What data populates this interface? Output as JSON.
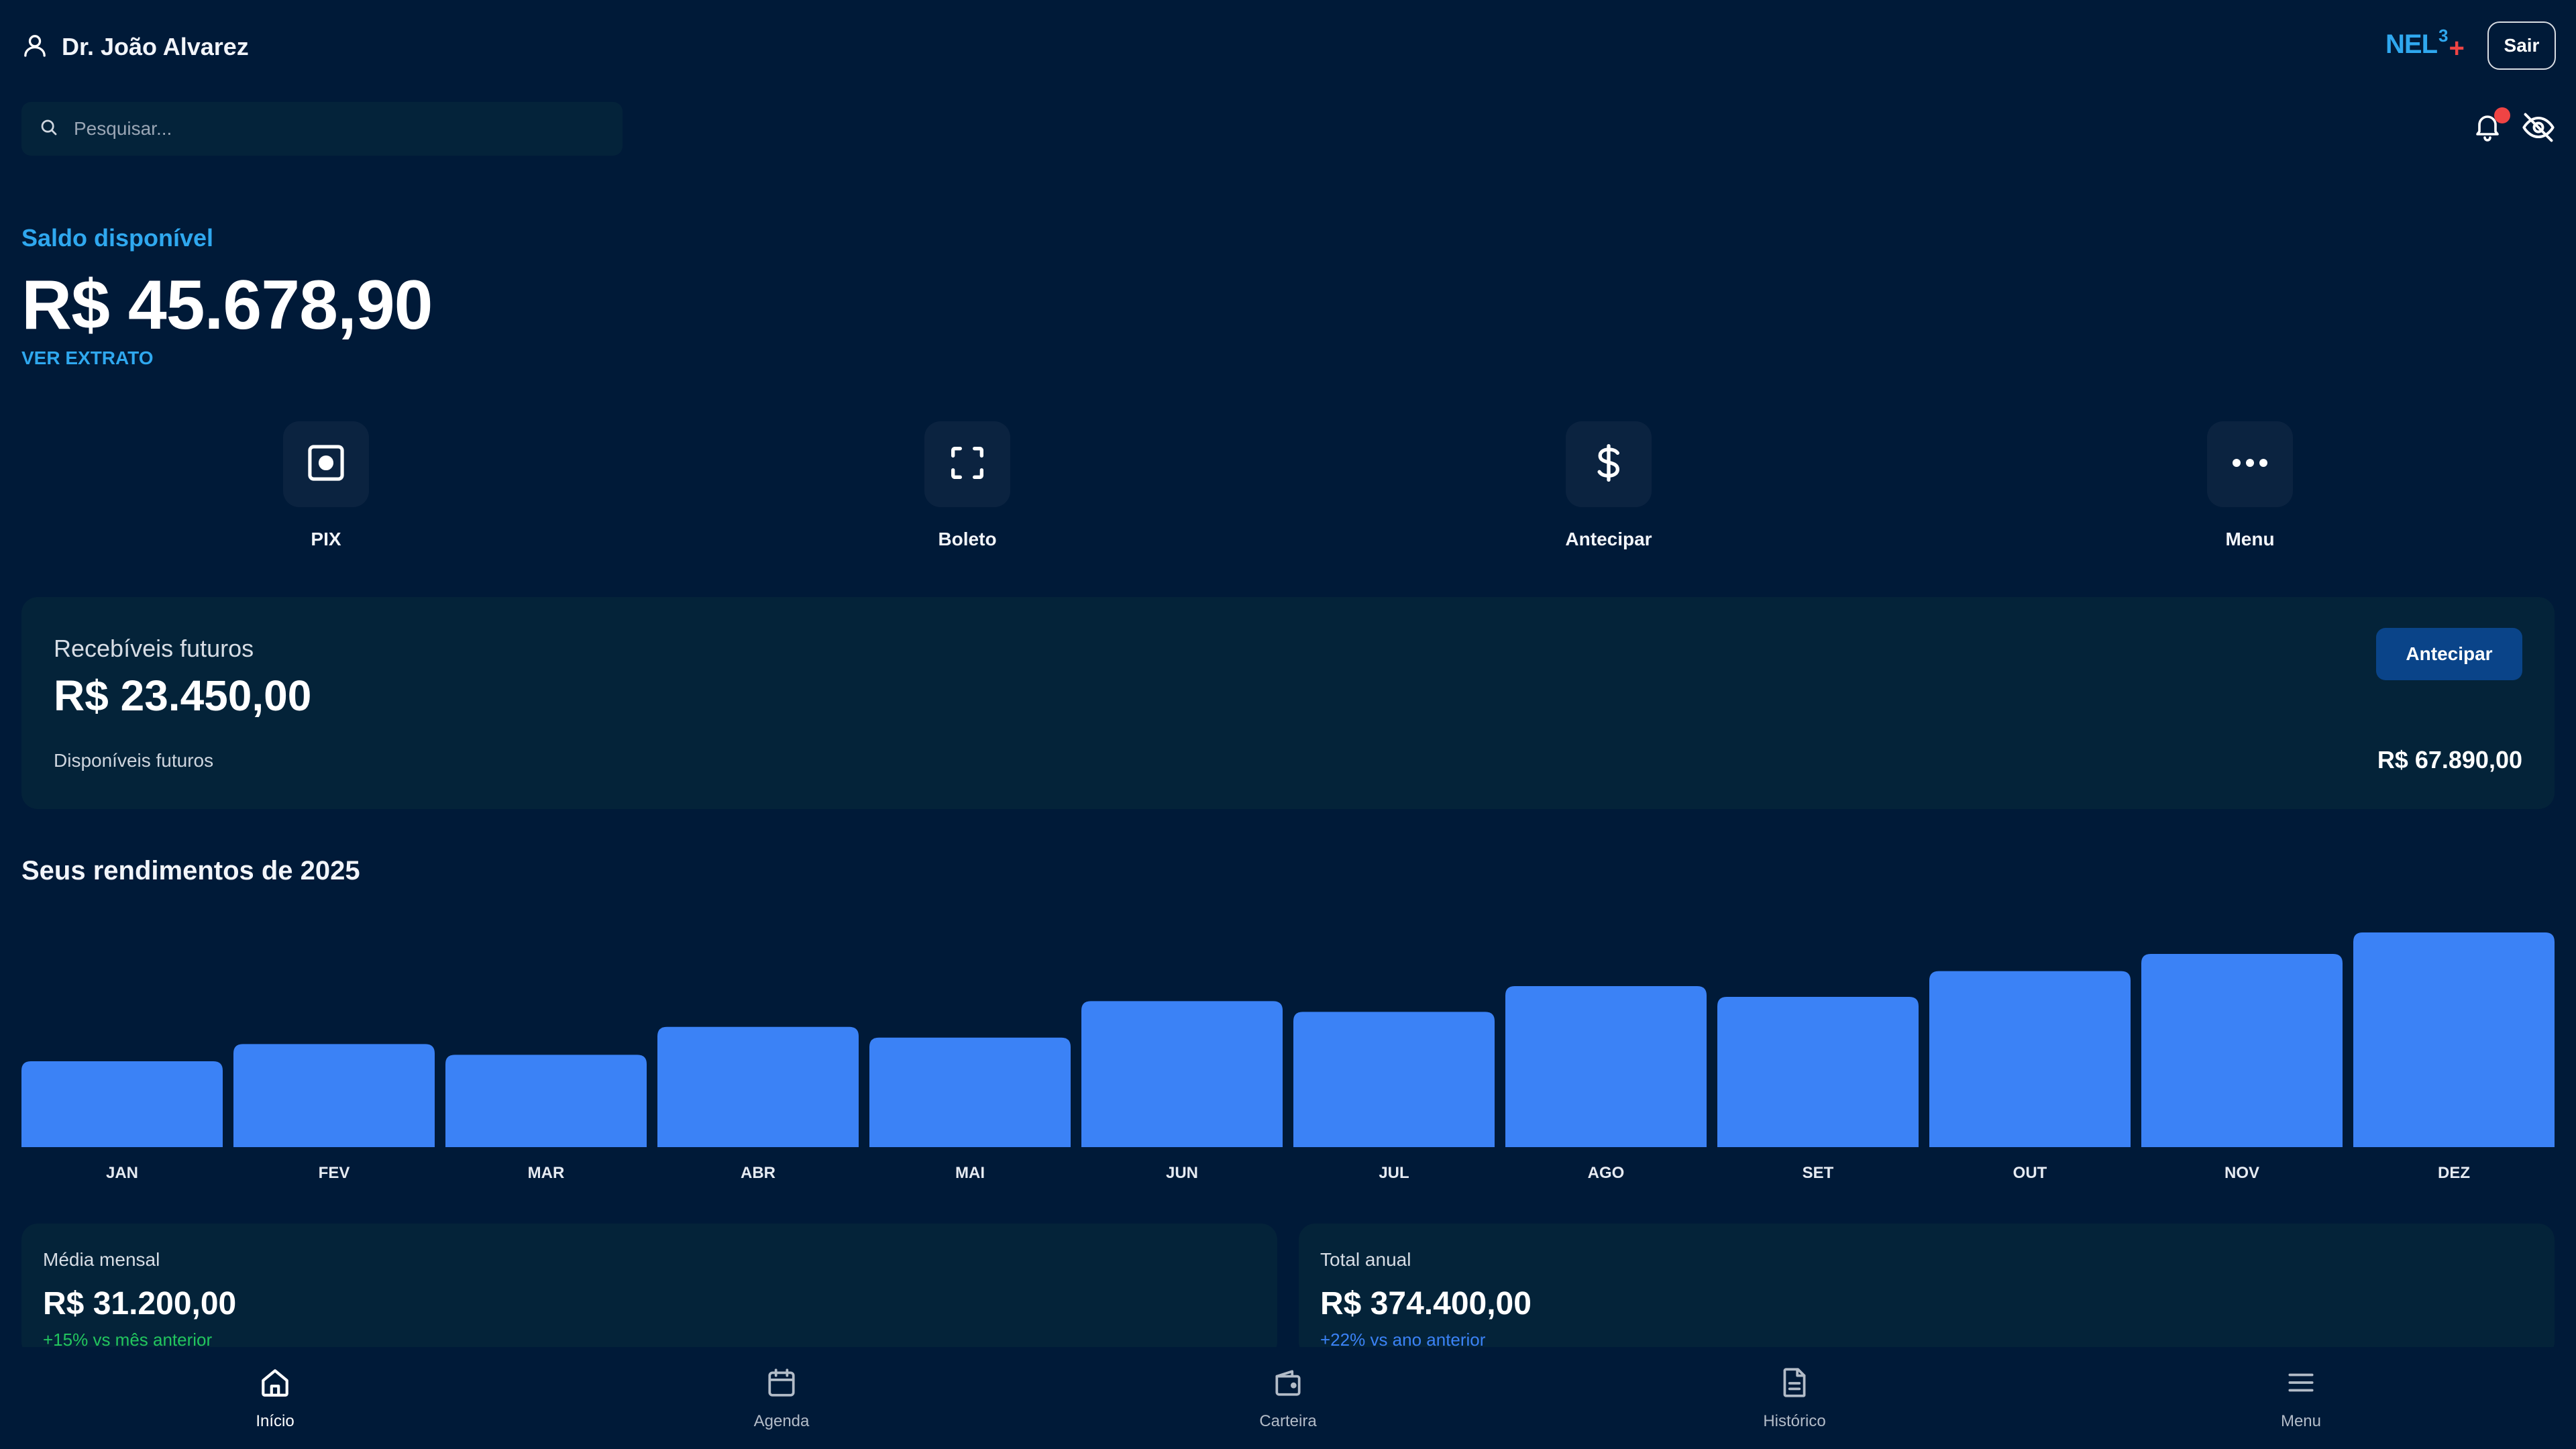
{
  "header": {
    "user_name": "Dr. João Alvarez",
    "brand": {
      "text": "NEL",
      "sup": "3",
      "plus": "+"
    },
    "logout_label": "Sair"
  },
  "search": {
    "placeholder": "Pesquisar..."
  },
  "icons": {
    "user": "user-icon",
    "search": "search-icon",
    "bell": "bell-icon",
    "eye_off": "eye-off-icon"
  },
  "balance": {
    "label": "Saldo disponível",
    "value": "R$ 45.678,90",
    "statement_link": "VER EXTRATO"
  },
  "quick_actions": [
    {
      "label": "PIX",
      "icon": "pix-icon"
    },
    {
      "label": "Boleto",
      "icon": "scan-icon"
    },
    {
      "label": "Antecipar",
      "icon": "dollar-icon"
    },
    {
      "label": "Menu",
      "icon": "more-icon"
    }
  ],
  "receivables": {
    "title": "Recebíveis futuros",
    "value": "R$ 23.450,00",
    "subtitle": "Disponíveis futuros",
    "future_amount": "R$ 67.890,00",
    "button_label": "Antecipar"
  },
  "chart_data": {
    "type": "bar",
    "title": "Seus rendimentos de 2025",
    "categories": [
      "JAN",
      "FEV",
      "MAR",
      "ABR",
      "MAI",
      "JUN",
      "JUL",
      "AGO",
      "SET",
      "OUT",
      "NOV",
      "DEZ"
    ],
    "values": [
      40,
      48,
      43,
      56,
      51,
      68,
      63,
      75,
      70,
      82,
      90,
      100
    ],
    "ylim": [
      0,
      100
    ],
    "xlabel": "",
    "ylabel": "",
    "grid": false,
    "bar_color": "#3b82f6"
  },
  "stats": {
    "monthly_avg": {
      "title": "Média mensal",
      "value": "R$ 31.200,00",
      "note": "+15% vs mês anterior"
    },
    "annual_total": {
      "title": "Total anual",
      "value": "R$ 374.400,00",
      "note": "+22% vs ano anterior"
    }
  },
  "bottom_nav": [
    {
      "label": "Início",
      "icon": "home-icon",
      "active": true
    },
    {
      "label": "Agenda",
      "icon": "calendar-icon",
      "active": false
    },
    {
      "label": "Carteira",
      "icon": "wallet-icon",
      "active": false
    },
    {
      "label": "Histórico",
      "icon": "document-icon",
      "active": false
    },
    {
      "label": "Menu",
      "icon": "hamburger-icon",
      "active": false
    }
  ],
  "colors": {
    "background": "#001a38",
    "accent": "#2fa8ef",
    "bar": "#3b82f6",
    "positive": "#22c55e",
    "alert": "#ef4444"
  }
}
